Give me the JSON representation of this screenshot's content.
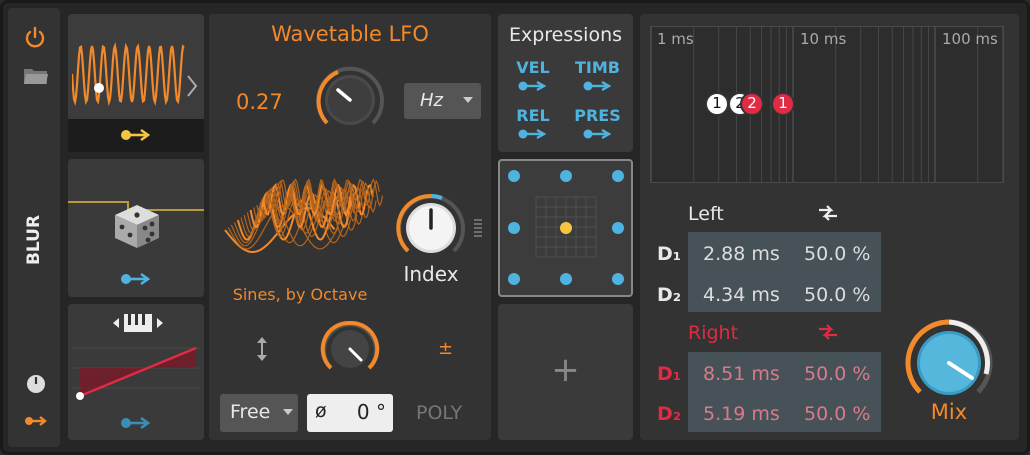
{
  "device": {
    "name": "BLUR"
  },
  "colors": {
    "accent": "#f2892b",
    "blue": "#4fb3e0",
    "red": "#e02b45",
    "yellow": "#f5c542"
  },
  "lfo": {
    "title": "Wavetable LFO",
    "rate_value": "0.27",
    "rate_unit": "Hz",
    "wavetable_name": "Sines, by Octave",
    "index_label": "Index",
    "bipolar_symbol": "±",
    "mode": "Free",
    "phase_symbol": "ø",
    "phase_value": "0 °",
    "poly_label": "POLY"
  },
  "expressions": {
    "title": "Expressions",
    "items": [
      "VEL",
      "TIMB",
      "REL",
      "PRES"
    ]
  },
  "add_label": "+",
  "timeline": {
    "ticks": [
      "1 ms",
      "10 ms",
      "100 ms"
    ],
    "markers": [
      "1",
      "2",
      "2",
      "1"
    ]
  },
  "delays": {
    "left": {
      "label": "Left",
      "rows": [
        {
          "name": "D₁",
          "time": "2.88 ms",
          "mix": "50.0 %"
        },
        {
          "name": "D₂",
          "time": "4.34 ms",
          "mix": "50.0 %"
        }
      ]
    },
    "right": {
      "label": "Right",
      "rows": [
        {
          "name": "D₁",
          "time": "8.51 ms",
          "mix": "50.0 %"
        },
        {
          "name": "D₂",
          "time": "5.19 ms",
          "mix": "50.0 %"
        }
      ]
    },
    "mix_label": "Mix",
    "mix_level": 0.7
  }
}
